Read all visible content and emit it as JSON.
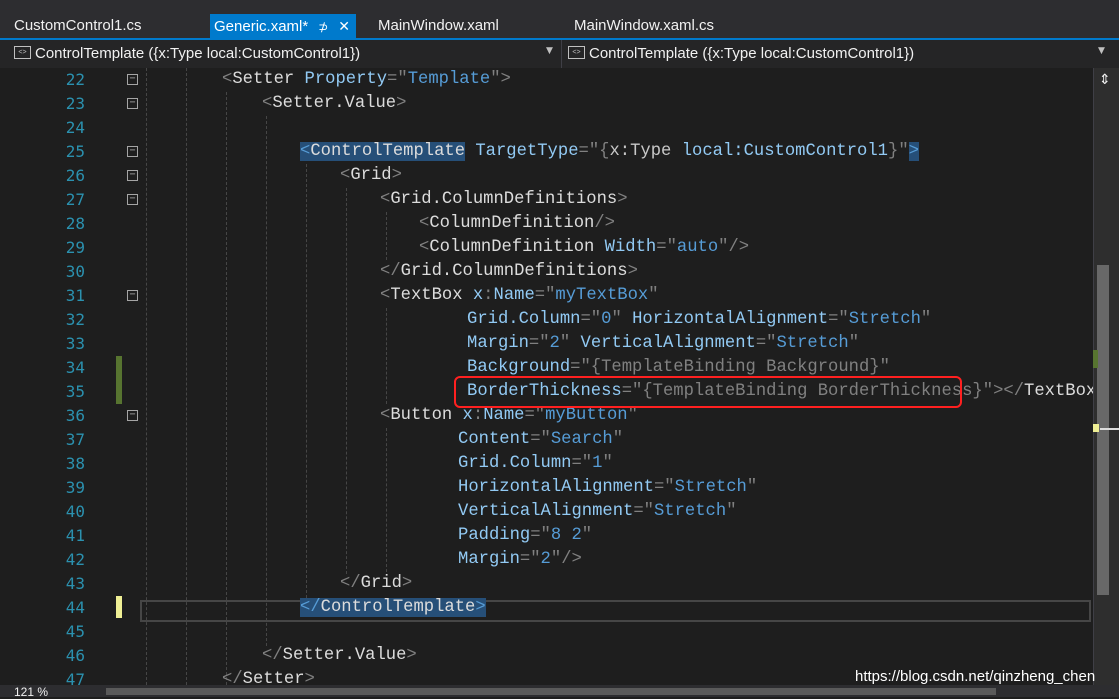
{
  "tabs": [
    {
      "label": "CustomControl1.cs"
    },
    {
      "label": "Generic.xaml*",
      "pin": "⊅",
      "close": "✕"
    },
    {
      "label": "MainWindow.xaml"
    },
    {
      "label": "MainWindow.xaml.cs"
    }
  ],
  "nav": {
    "left": "ControlTemplate ({x:Type local:CustomControl1})",
    "right": "ControlTemplate ({x:Type local:CustomControl1})"
  },
  "lines": [
    {
      "n": "22"
    },
    {
      "n": "23"
    },
    {
      "n": "24"
    },
    {
      "n": "25"
    },
    {
      "n": "26"
    },
    {
      "n": "27"
    },
    {
      "n": "28"
    },
    {
      "n": "29"
    },
    {
      "n": "30"
    },
    {
      "n": "31"
    },
    {
      "n": "32"
    },
    {
      "n": "33"
    },
    {
      "n": "34"
    },
    {
      "n": "35"
    },
    {
      "n": "36"
    },
    {
      "n": "37"
    },
    {
      "n": "38"
    },
    {
      "n": "39"
    },
    {
      "n": "40"
    },
    {
      "n": "41"
    },
    {
      "n": "42"
    },
    {
      "n": "43"
    },
    {
      "n": "44"
    },
    {
      "n": "45"
    },
    {
      "n": "46"
    },
    {
      "n": "47"
    }
  ],
  "code": {
    "l22": {
      "t1": "<",
      "el": "Setter",
      "a1": " Property",
      "eq": "=\"",
      "v1": "Template",
      "q": "\"",
      ">": ">"
    },
    "l23": {
      "t": "<",
      "el": "Setter.Value",
      "c": ">"
    },
    "l25": {
      "lt": "<",
      "el": "ControlTemplate",
      "attr": " TargetType",
      "eq": "=\"",
      "br": "{",
      "x": "x:Type",
      "sp": " ",
      "lc": "local:CustomControl1",
      "br2": "}",
      "q": "\"",
      "gt": ">"
    },
    "l26": {
      "t": "<",
      "el": "Grid",
      "c": ">"
    },
    "l27": {
      "t": "<",
      "el": "Grid.ColumnDefinitions",
      "c": ">"
    },
    "l28": {
      "t": "<",
      "el": "ColumnDefinition",
      "c": "/>"
    },
    "l29": {
      "t": "<",
      "el": "ColumnDefinition",
      "a": " Width",
      "eq": "=\"",
      "v": "auto",
      "q": "\"",
      "c": "/>"
    },
    "l30": {
      "t": "</",
      "el": "Grid.ColumnDefinitions",
      "c": ">"
    },
    "l31": {
      "t": "<",
      "el": "TextBox",
      "a": " x",
      "col": ":",
      "a2": "Name",
      "eq": "=\"",
      "v": "myTextBox",
      "q": "\""
    },
    "l32": {
      "a": "Grid.Column",
      "eq": "=\"",
      "v": "0",
      "q": "\"",
      "a2": " HorizontalAlignment",
      "eq2": "=\"",
      "v2": "Stretch",
      "q2": "\""
    },
    "l33": {
      "a": "Margin",
      "eq": "=\"",
      "v": "2",
      "q": "\"",
      "a2": " VerticalAlignment",
      "eq2": "=\"",
      "v2": "Stretch",
      "q2": "\""
    },
    "l34": {
      "a": "Background",
      "eq": "=\"",
      "v": "{TemplateBinding Background}",
      "q": "\""
    },
    "l35": {
      "a": "BorderThickness",
      "eq": "=\"",
      "v": "{TemplateBinding BorderThickness}",
      "q": "\"",
      "c": "></",
      "el": "TextBox",
      "c2": ">"
    },
    "l36": {
      "t": "<",
      "el": "Button",
      "a": " x",
      "col": ":",
      "a2": "Name",
      "eq": "=\"",
      "v": "myButton",
      "q": "\""
    },
    "l37": {
      "a": "Content",
      "eq": "=\"",
      "v": "Search",
      "q": "\""
    },
    "l38": {
      "a": "Grid.Column",
      "eq": "=\"",
      "v": "1",
      "q": "\""
    },
    "l39": {
      "a": "HorizontalAlignment",
      "eq": "=\"",
      "v": "Stretch",
      "q": "\""
    },
    "l40": {
      "a": "VerticalAlignment",
      "eq": "=\"",
      "v": "Stretch",
      "q": "\""
    },
    "l41": {
      "a": "Padding",
      "eq": "=\"",
      "v": "8 2",
      "q": "\""
    },
    "l42": {
      "a": "Margin",
      "eq": "=\"",
      "v": "2",
      "q": "\"",
      "c": "/>"
    },
    "l43": {
      "t": "</",
      "el": "Grid",
      "c": ">"
    },
    "l44": {
      "t": "</",
      "el": "ControlTemplate",
      "c": ">"
    },
    "l46": {
      "t": "</",
      "el": "Setter.Value",
      "c": ">"
    },
    "l47": {
      "t": "</",
      "el": "Setter",
      "c": ">"
    }
  },
  "status": {
    "zoom": "121 %"
  },
  "watermark": "https://blog.csdn.net/qinzheng_chen",
  "colors": {
    "accent": "#007acc",
    "highlight": "#ff2020",
    "changed": "#577430",
    "unsaved": "#efef95"
  }
}
